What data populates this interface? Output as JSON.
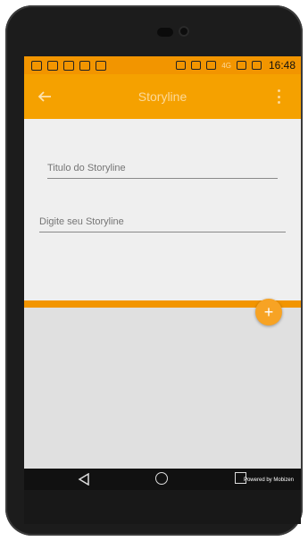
{
  "statusbar": {
    "network_label": "4G",
    "time": "16:48"
  },
  "toolbar": {
    "back_icon": "arrow-left-icon",
    "title": "Storyline",
    "menu_icon": "more-vert-icon"
  },
  "form": {
    "title_placeholder": "Titulo do Storyline",
    "story_placeholder": "Digite seu Storyline"
  },
  "fab": {
    "icon": "plus-icon",
    "label": "+"
  },
  "navbar": {
    "back_icon": "nav-back-triangle-icon",
    "home_icon": "nav-home-circle-icon",
    "recent_icon": "nav-recent-square-icon",
    "powered_by": "Powered by Mobizen"
  },
  "colors": {
    "accent": "#f29500",
    "toolbar": "#f5a100",
    "fab": "#f7a324",
    "background": "#efefef",
    "screen_bg": "#e0e0e0",
    "navbar": "#111111",
    "bezel": "#1c1c1c"
  }
}
